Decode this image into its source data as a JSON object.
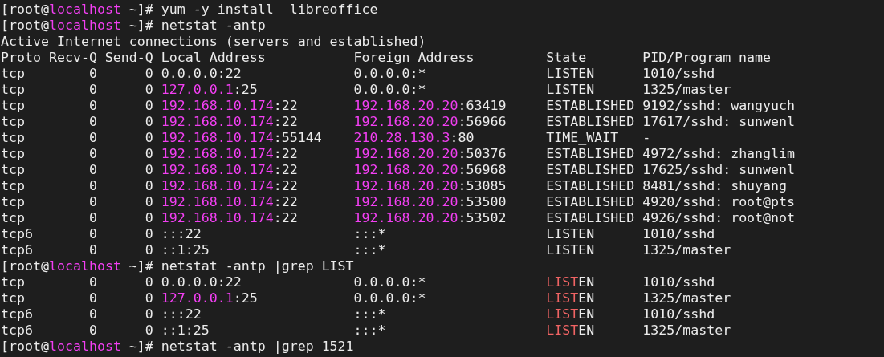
{
  "terminal": {
    "lines": [
      [
        {
          "text": "[root@",
          "kind": "plain"
        },
        {
          "text": "localhost",
          "kind": "highlight"
        },
        {
          "text": " ~]# yum -y install  libreoffice",
          "kind": "plain"
        }
      ],
      [
        {
          "text": "[root@",
          "kind": "plain"
        },
        {
          "text": "localhost",
          "kind": "highlight"
        },
        {
          "text": " ~]# netstat -antp",
          "kind": "plain"
        }
      ],
      [
        {
          "text": "Active Internet connections (servers and established)",
          "kind": "plain"
        }
      ],
      [
        {
          "text": "Proto Recv-Q Send-Q Local Address           Foreign Address         State       PID/Program name",
          "kind": "plain"
        }
      ],
      [
        {
          "text": "tcp        0      0 0.0.0.0:22              0.0.0.0:*               LISTEN      1010/sshd",
          "kind": "plain"
        }
      ],
      [
        {
          "text": "tcp        0      0 ",
          "kind": "plain"
        },
        {
          "text": "127.0.0.1",
          "kind": "highlight"
        },
        {
          "text": ":25            0.0.0.0:*               LISTEN      1325/master",
          "kind": "plain"
        }
      ],
      [
        {
          "text": "tcp        0      0 ",
          "kind": "plain"
        },
        {
          "text": "192.168.10.174",
          "kind": "highlight"
        },
        {
          "text": ":22       ",
          "kind": "plain"
        },
        {
          "text": "192.168.20.20",
          "kind": "highlight"
        },
        {
          "text": ":63419     ESTABLISHED 9192/sshd: wangyuch",
          "kind": "plain"
        }
      ],
      [
        {
          "text": "tcp        0      0 ",
          "kind": "plain"
        },
        {
          "text": "192.168.10.174",
          "kind": "highlight"
        },
        {
          "text": ":22       ",
          "kind": "plain"
        },
        {
          "text": "192.168.20.20",
          "kind": "highlight"
        },
        {
          "text": ":56966     ESTABLISHED 17617/sshd: sunwenl",
          "kind": "plain"
        }
      ],
      [
        {
          "text": "tcp        0      0 ",
          "kind": "plain"
        },
        {
          "text": "192.168.10.174",
          "kind": "highlight"
        },
        {
          "text": ":55144    ",
          "kind": "plain"
        },
        {
          "text": "210.28.130.3",
          "kind": "highlight"
        },
        {
          "text": ":80         TIME_WAIT   -",
          "kind": "plain"
        }
      ],
      [
        {
          "text": "tcp        0      0 ",
          "kind": "plain"
        },
        {
          "text": "192.168.10.174",
          "kind": "highlight"
        },
        {
          "text": ":22       ",
          "kind": "plain"
        },
        {
          "text": "192.168.20.20",
          "kind": "highlight"
        },
        {
          "text": ":50376     ESTABLISHED 4972/sshd: zhanglim",
          "kind": "plain"
        }
      ],
      [
        {
          "text": "tcp        0      0 ",
          "kind": "plain"
        },
        {
          "text": "192.168.10.174",
          "kind": "highlight"
        },
        {
          "text": ":22       ",
          "kind": "plain"
        },
        {
          "text": "192.168.20.20",
          "kind": "highlight"
        },
        {
          "text": ":56968     ESTABLISHED 17625/sshd: sunwenl",
          "kind": "plain"
        }
      ],
      [
        {
          "text": "tcp        0      0 ",
          "kind": "plain"
        },
        {
          "text": "192.168.10.174",
          "kind": "highlight"
        },
        {
          "text": ":22       ",
          "kind": "plain"
        },
        {
          "text": "192.168.20.20",
          "kind": "highlight"
        },
        {
          "text": ":53085     ESTABLISHED 8481/sshd: shuyang",
          "kind": "plain"
        }
      ],
      [
        {
          "text": "tcp        0      0 ",
          "kind": "plain"
        },
        {
          "text": "192.168.10.174",
          "kind": "highlight"
        },
        {
          "text": ":22       ",
          "kind": "plain"
        },
        {
          "text": "192.168.20.20",
          "kind": "highlight"
        },
        {
          "text": ":53500     ESTABLISHED 4920/sshd: root@pts",
          "kind": "plain"
        }
      ],
      [
        {
          "text": "tcp        0      0 ",
          "kind": "plain"
        },
        {
          "text": "192.168.10.174",
          "kind": "highlight"
        },
        {
          "text": ":22       ",
          "kind": "plain"
        },
        {
          "text": "192.168.20.20",
          "kind": "highlight"
        },
        {
          "text": ":53502     ESTABLISHED 4926/sshd: root@not",
          "kind": "plain"
        }
      ],
      [
        {
          "text": "tcp6       0      0 :::22                   :::*                    LISTEN      1010/sshd",
          "kind": "plain"
        }
      ],
      [
        {
          "text": "tcp6       0      0 ::1:25                  :::*                    LISTEN      1325/master",
          "kind": "plain"
        }
      ],
      [
        {
          "text": "[root@",
          "kind": "plain"
        },
        {
          "text": "localhost",
          "kind": "highlight"
        },
        {
          "text": " ~]# netstat -antp |grep LIST",
          "kind": "plain"
        }
      ],
      [
        {
          "text": "tcp        0      0 0.0.0.0:22              0.0.0.0:*               ",
          "kind": "plain"
        },
        {
          "text": "LIST",
          "kind": "match"
        },
        {
          "text": "EN      1010/sshd",
          "kind": "plain"
        }
      ],
      [
        {
          "text": "tcp        0      0 ",
          "kind": "plain"
        },
        {
          "text": "127.0.0.1",
          "kind": "highlight"
        },
        {
          "text": ":25            0.0.0.0:*               ",
          "kind": "plain"
        },
        {
          "text": "LIST",
          "kind": "match"
        },
        {
          "text": "EN      1325/master",
          "kind": "plain"
        }
      ],
      [
        {
          "text": "tcp6       0      0 :::22                   :::*                    ",
          "kind": "plain"
        },
        {
          "text": "LIST",
          "kind": "match"
        },
        {
          "text": "EN      1010/sshd",
          "kind": "plain"
        }
      ],
      [
        {
          "text": "tcp6       0      0 ::1:25                  :::*                    ",
          "kind": "plain"
        },
        {
          "text": "LIST",
          "kind": "match"
        },
        {
          "text": "EN      1325/master",
          "kind": "plain"
        }
      ],
      [
        {
          "text": "[root@",
          "kind": "plain"
        },
        {
          "text": "localhost",
          "kind": "highlight"
        },
        {
          "text": " ~]# netstat -antp |grep 1521",
          "kind": "plain"
        }
      ]
    ]
  }
}
